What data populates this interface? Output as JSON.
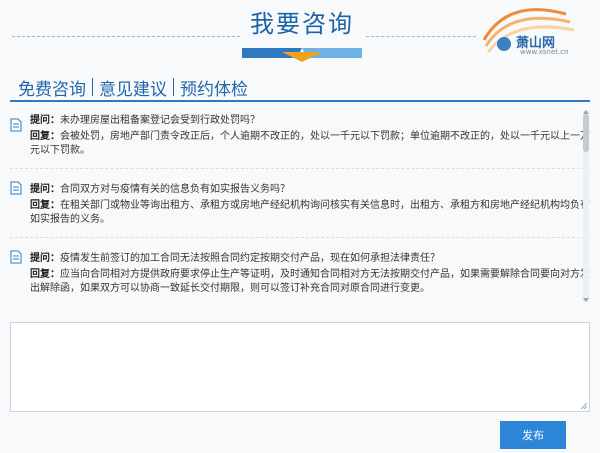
{
  "header": {
    "title": "我要咨询",
    "logo_name": "萧山网",
    "logo_url": "www.xsnet.cn"
  },
  "tabs": [
    {
      "label": "免费咨询"
    },
    {
      "label": "意见建议"
    },
    {
      "label": "预约体检"
    }
  ],
  "qa": {
    "question_label": "提问：",
    "answer_label": "回复：",
    "items": [
      {
        "question": "未办理房屋出租备案登记会受到行政处罚吗？",
        "answer": "会被处罚，房地产部门责令改正后，个人逾期不改正的，处以一千元以下罚款；单位逾期不改正的，处以一千元以上一万元以下罚款。"
      },
      {
        "question": "合同双方对与疫情有关的信息负有如实报告义务吗？",
        "answer": "在租关部门或物业等询出租方、承租方或房地产经纪机构询问核实有关信息时，出租方、承租方和房地产经纪机构均负有如实报告的义务。"
      },
      {
        "question": "疫情发生前签订的加工合同无法按照合同约定按期交付产品，现在如何承担法律责任？",
        "answer": "应当向合同相对方提供政府要求停止生产等证明，及时通知合同相对方无法按期交付产品，如果需要解除合同要向对方发出解除函，如果双方可以协商一致延长交付期限，则可以签订补充合同对原合同进行变更。"
      }
    ]
  },
  "input": {
    "value": "",
    "placeholder": ""
  },
  "submit": {
    "label": "发布"
  },
  "colors": {
    "accent": "#2c85d6",
    "tab_text": "#2266aa",
    "title": "#1b63a8"
  }
}
